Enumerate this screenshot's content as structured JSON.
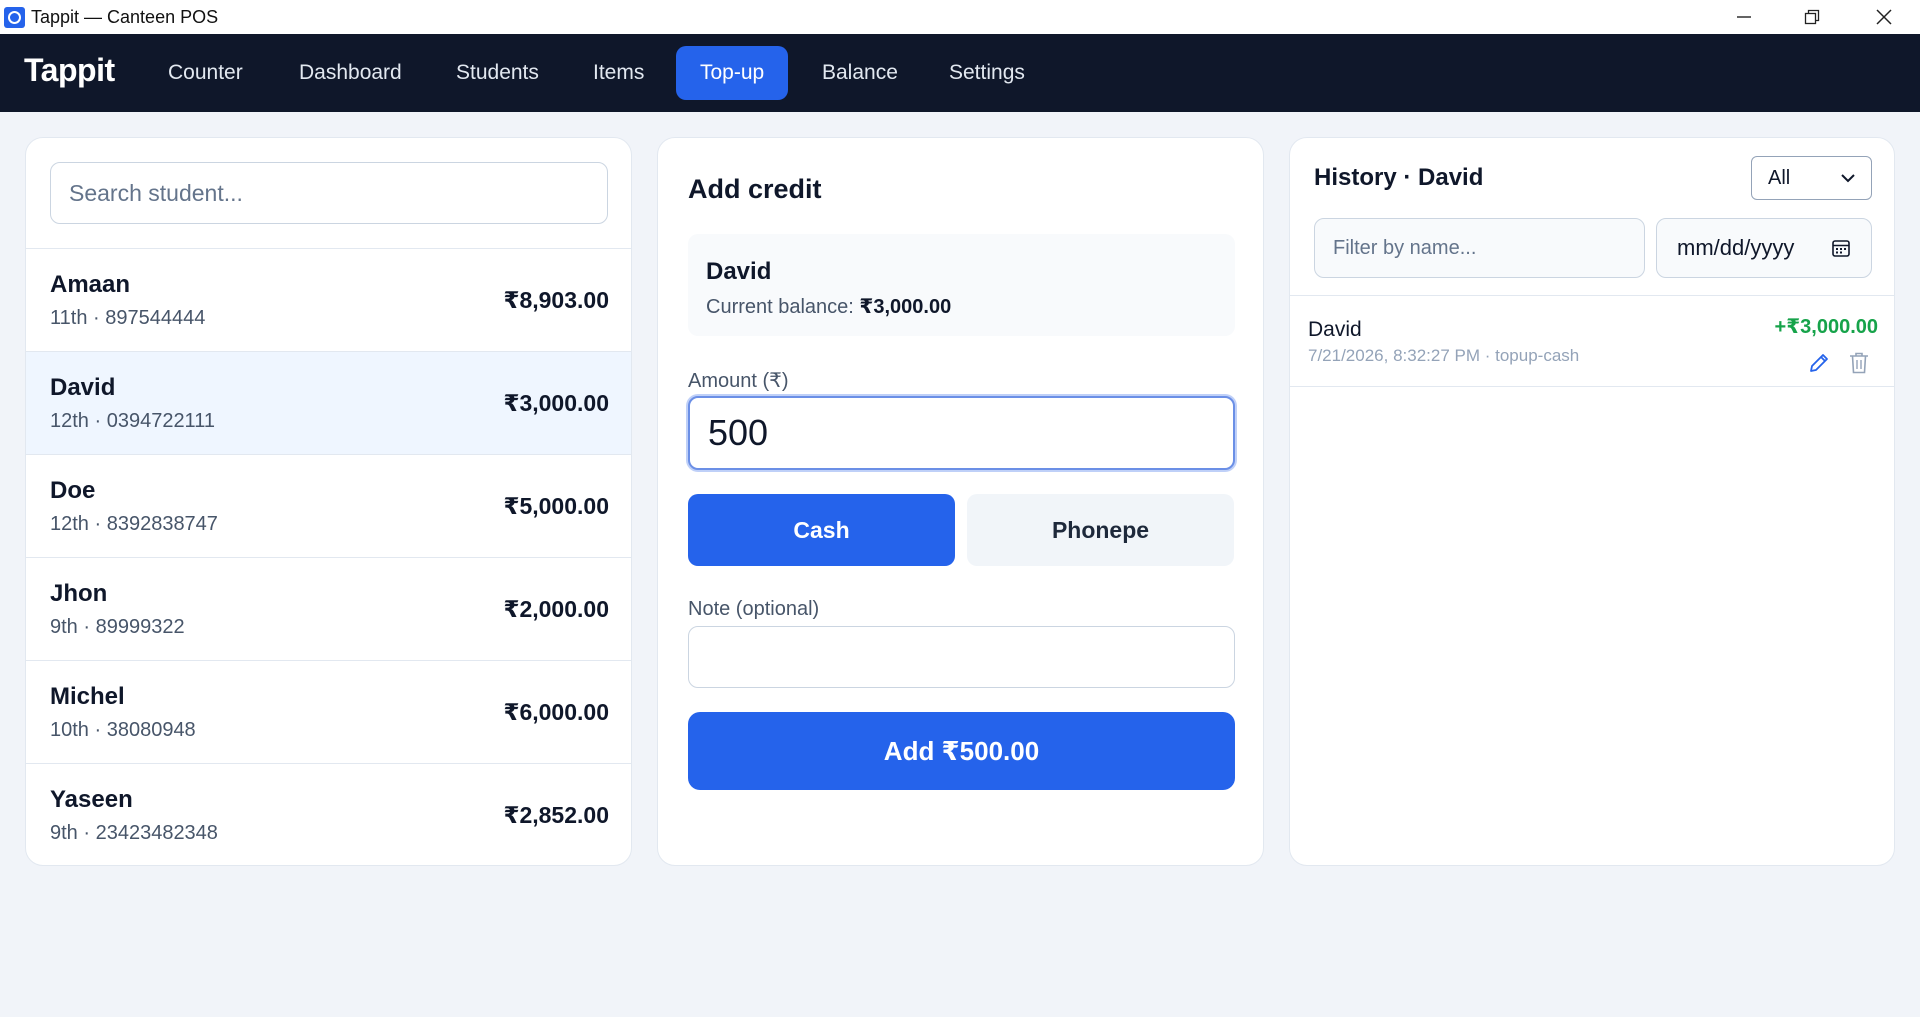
{
  "window": {
    "title": "Tappit — Canteen POS"
  },
  "nav": {
    "brand": "Tappit",
    "items": [
      {
        "label": "Counter"
      },
      {
        "label": "Dashboard"
      },
      {
        "label": "Students"
      },
      {
        "label": "Items"
      },
      {
        "label": "Top-up",
        "active": true
      },
      {
        "label": "Balance"
      },
      {
        "label": "Settings"
      }
    ]
  },
  "students": {
    "search_placeholder": "Search student...",
    "rows": [
      {
        "name": "Amaan",
        "meta": "11th · 897544444",
        "balance": "₹8,903.00"
      },
      {
        "name": "David",
        "meta": "12th · 0394722111",
        "balance": "₹3,000.00",
        "selected": true
      },
      {
        "name": "Doe",
        "meta": "12th · 8392838747",
        "balance": "₹5,000.00"
      },
      {
        "name": "Jhon",
        "meta": "9th · 89999322",
        "balance": "₹2,000.00"
      },
      {
        "name": "Michel",
        "meta": "10th · 38080948",
        "balance": "₹6,000.00"
      },
      {
        "name": "Yaseen",
        "meta": "9th · 23423482348",
        "balance": "₹2,852.00"
      }
    ]
  },
  "credit": {
    "title": "Add credit",
    "selected_name": "David",
    "balance_label": "Current balance: ",
    "balance_value": "₹3,000.00",
    "amount_label": "Amount (₹)",
    "amount_value": "500",
    "method_cash": "Cash",
    "method_phonepe": "Phonepe",
    "note_label": "Note (optional)",
    "note_value": "",
    "submit_label": "Add ₹500.00"
  },
  "history": {
    "title": "History · David",
    "filter_selected": "All",
    "filter_placeholder": "Filter by name...",
    "date_placeholder": "mm/dd/yyyy",
    "rows": [
      {
        "name": "David",
        "meta": "7/21/2026, 8:32:27 PM · topup-cash",
        "amount": "+₹3,000.00"
      }
    ]
  },
  "colors": {
    "accent": "#2563eb",
    "nav_bg": "#0f172a",
    "positive": "#16a34a",
    "page_bg": "#f1f4f9"
  }
}
